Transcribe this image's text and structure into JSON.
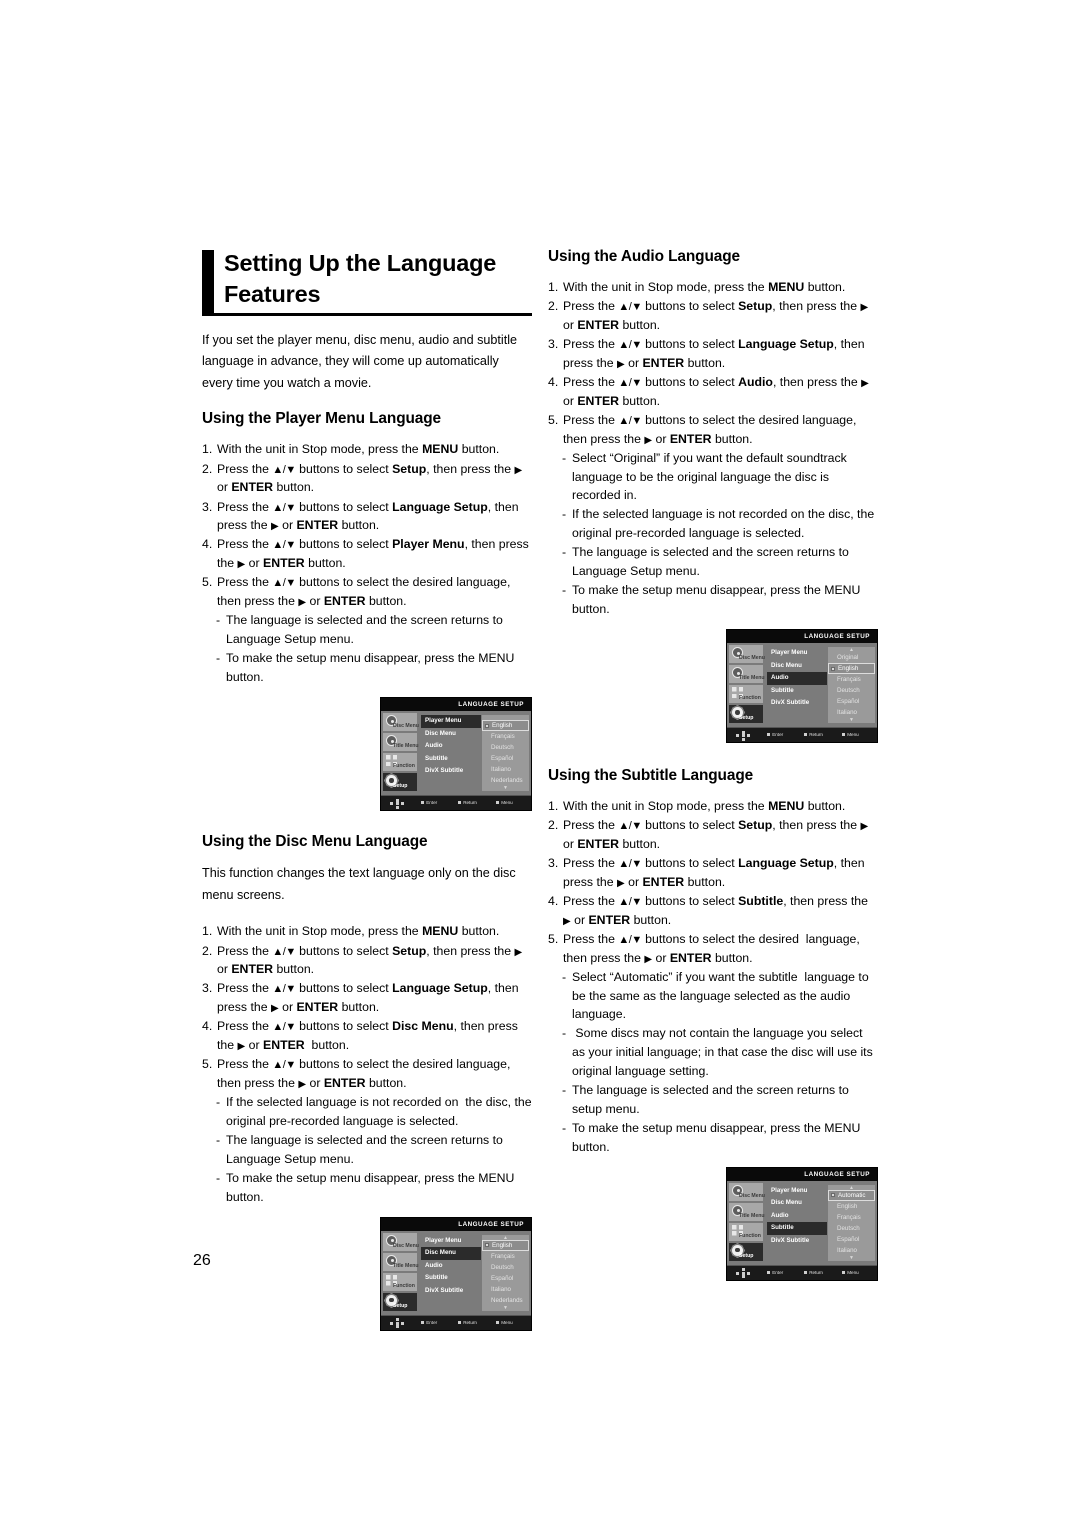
{
  "page_number": "26",
  "title": {
    "line1": "Setting Up the Language",
    "line2": "Features"
  },
  "intro": "If you set the player menu, disc menu, audio and subtitle language in advance, they will come up automatically every time you watch a movie.",
  "sections": {
    "player_menu": {
      "heading": "Using the Player Menu Language",
      "steps": [
        {
          "num": "1.",
          "text_html": "With the unit in Stop mode, press the <b>MENU</b> button."
        },
        {
          "num": "2.",
          "text_html": "Press the <span class=\"arrow-ud\">▲/▼</span> buttons to select <b>Setup</b>, then press the <span class=\"arrow-r\">▶</span> or <b>ENTER</b> button."
        },
        {
          "num": "3.",
          "text_html": "Press the <span class=\"arrow-ud\">▲/▼</span> buttons to select <b>Language Setup</b>, then press the <span class=\"arrow-r\">▶</span> or <b>ENTER</b> button."
        },
        {
          "num": "4.",
          "text_html": "Press the <span class=\"arrow-ud\">▲/▼</span> buttons to select <b>Player Menu</b>, then press the <span class=\"arrow-r\">▶</span> or <b>ENTER</b> button."
        },
        {
          "num": "5.",
          "text_html": "Press the <span class=\"arrow-ud\">▲/▼</span> buttons to select the desired language, then press the <span class=\"arrow-r\">▶</span> or <b>ENTER</b> button."
        }
      ],
      "notes": [
        "The language is selected and the screen returns to Language Setup menu.",
        "To make the setup menu disappear, press the MENU button."
      ]
    },
    "disc_menu": {
      "heading": "Using the Disc Menu Language",
      "para": "This function changes the text language only on the disc menu screens.",
      "steps": [
        {
          "num": "1.",
          "text_html": "With the unit in Stop mode, press the <b>MENU</b> button."
        },
        {
          "num": "2.",
          "text_html": "Press the <span class=\"arrow-ud\">▲/▼</span> buttons to select <b>Setup</b>, then press the <span class=\"arrow-r\">▶</span> or <b>ENTER</b> button."
        },
        {
          "num": "3.",
          "text_html": "Press the <span class=\"arrow-ud\">▲/▼</span> buttons to select <b>Language Setup</b>, then press the <span class=\"arrow-r\">▶</span> or <b>ENTER</b> button."
        },
        {
          "num": "4.",
          "text_html": "Press the <span class=\"arrow-ud\">▲/▼</span> buttons to select <b>Disc Menu</b>, then press the <span class=\"arrow-r\">▶</span> or <b>ENTER</b>&nbsp; button."
        },
        {
          "num": "5.",
          "text_html": "Press the <span class=\"arrow-ud\">▲/▼</span> buttons to select the desired language, then press the <span class=\"arrow-r\">▶</span> or <b>ENTER</b> button."
        }
      ],
      "notes": [
        "If the selected language is not recorded on&nbsp; the disc, the original pre-recorded language is selected.",
        "The language is selected and the screen returns to Language Setup menu.",
        "To make the setup menu disappear, press the MENU button."
      ]
    },
    "audio": {
      "heading": "Using the Audio Language",
      "steps": [
        {
          "num": "1.",
          "text_html": "With the unit in Stop mode, press the <b>MENU</b> button."
        },
        {
          "num": "2.",
          "text_html": "Press the <span class=\"arrow-ud\">▲/▼</span> buttons to select <b>Setup</b>, then press the <span class=\"arrow-r\">▶</span> or <b>ENTER</b> button."
        },
        {
          "num": "3.",
          "text_html": "Press the <span class=\"arrow-ud\">▲/▼</span> buttons to select <b>Language Setup</b>, then press the <span class=\"arrow-r\">▶</span> or <b>ENTER</b> button."
        },
        {
          "num": "4.",
          "text_html": "Press the <span class=\"arrow-ud\">▲/▼</span> buttons to select <b>Audio</b>, then press the <span class=\"arrow-r\">▶</span> or <b>ENTER</b> button."
        },
        {
          "num": "5.",
          "text_html": "Press the <span class=\"arrow-ud\">▲/▼</span> buttons to select the desired language, then press the <span class=\"arrow-r\">▶</span> or <b>ENTER</b> button."
        }
      ],
      "notes": [
        "Select “Original” if you want the default soundtrack language to be the original language the disc is recorded in.",
        "If the selected language is not recorded on the disc, the original pre-recorded language is selected.",
        "The language is selected and the screen returns to Language Setup menu.",
        "To make the setup menu disappear, press the MENU button."
      ]
    },
    "subtitle": {
      "heading": "Using the Subtitle Language",
      "steps": [
        {
          "num": "1.",
          "text_html": "With the unit in Stop mode, press the <b>MENU</b> button."
        },
        {
          "num": "2.",
          "text_html": "Press the <span class=\"arrow-ud\">▲/▼</span> buttons to select <b>Setup</b>, then press the <span class=\"arrow-r\">▶</span> or <b>ENTER</b> button."
        },
        {
          "num": "3.",
          "text_html": "Press the <span class=\"arrow-ud\">▲/▼</span> buttons to select <b>Language Setup</b>, then press the <span class=\"arrow-r\">▶</span> or <b>ENTER</b> button."
        },
        {
          "num": "4.",
          "text_html": "Press the <span class=\"arrow-ud\">▲/▼</span> buttons to select <b>Subtitle</b>, then press the <span class=\"arrow-r\">▶</span> or <b>ENTER</b> button."
        },
        {
          "num": "5.",
          "text_html": "Press the <span class=\"arrow-ud\">▲/▼</span> buttons to select the desired&nbsp; language, then press the <span class=\"arrow-r\">▶</span> or <b>ENTER</b> button."
        }
      ],
      "notes": [
        "Select “Automatic” if you want the subtitle&nbsp; language to be the same as the language selected as the audio language.",
        "&nbsp;Some discs may not contain the language you select as your initial language; in that case the disc will use its original language setting.",
        "The language is selected and the screen returns to setup menu.",
        "To make the setup menu disappear, press the MENU button."
      ]
    }
  },
  "osd": {
    "title": "LANGUAGE SETUP",
    "side_items": [
      {
        "label": "Disc Menu",
        "icon": "disc-icon"
      },
      {
        "label": "Title Menu",
        "icon": "title-icon"
      },
      {
        "label": "Function",
        "icon": "function-icon"
      },
      {
        "label": "Setup",
        "icon": "gear-icon"
      }
    ],
    "menu_items": [
      "Player Menu",
      "Disc Menu",
      "Audio",
      "Subtitle",
      "DivX Subtitle"
    ],
    "footer": {
      "enter": "Enter",
      "return": "Return",
      "menu": "Menu"
    },
    "screens": {
      "player_menu": {
        "active_item": "Player Menu",
        "scroll_up": false,
        "scroll_down": true,
        "options": [
          "English",
          "Français",
          "Deutsch",
          "Español",
          "Italiano",
          "Nederlands"
        ],
        "selected_option": "English"
      },
      "disc_menu": {
        "active_item": "Disc Menu",
        "scroll_up": true,
        "scroll_down": true,
        "options": [
          "English",
          "Français",
          "Deutsch",
          "Español",
          "Italiano",
          "Nederlands"
        ],
        "selected_option": "English"
      },
      "audio": {
        "active_item": "Audio",
        "scroll_up": true,
        "scroll_down": true,
        "options": [
          "Original",
          "English",
          "Français",
          "Deutsch",
          "Español",
          "Italiano"
        ],
        "selected_option": "English"
      },
      "subtitle": {
        "active_item": "Subtitle",
        "scroll_up": true,
        "scroll_down": true,
        "options": [
          "Automatic",
          "English",
          "Français",
          "Deutsch",
          "Español",
          "Italiano"
        ],
        "selected_option": "Automatic"
      }
    }
  }
}
